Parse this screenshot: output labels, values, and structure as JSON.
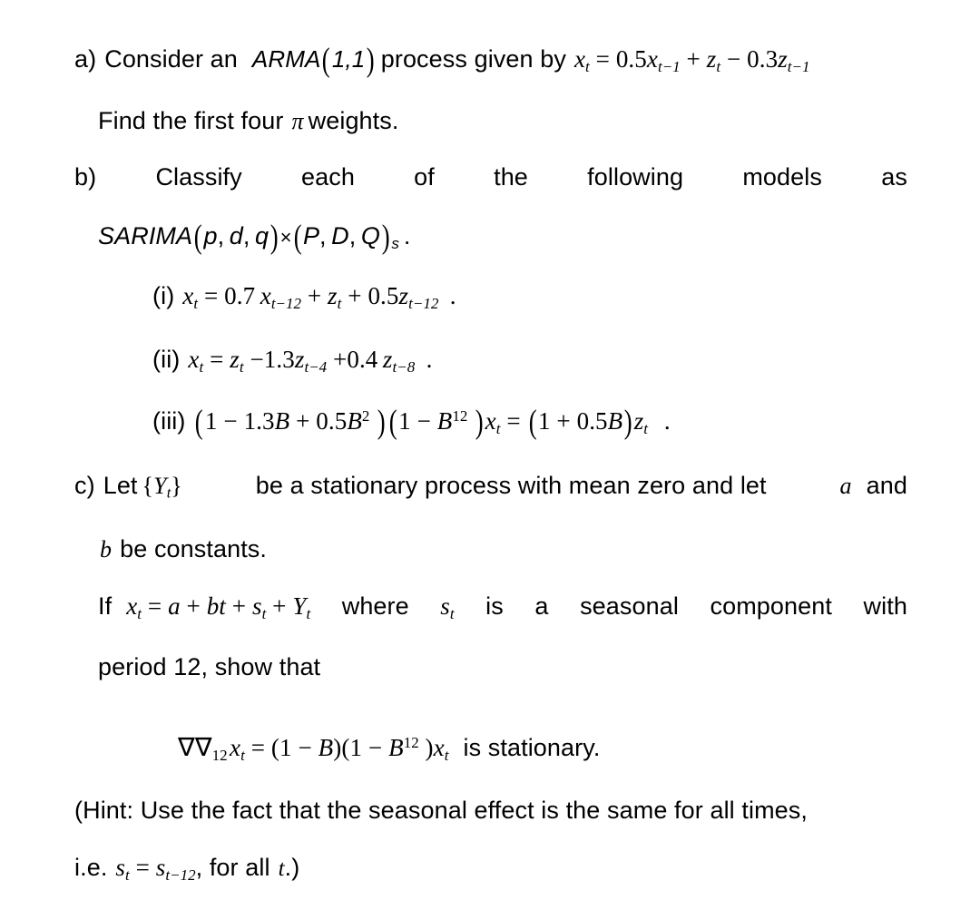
{
  "document": {
    "type": "exam-question-sheet",
    "background_color": "#ffffff",
    "text_color": "#000000"
  },
  "items": {
    "a": {
      "label": "a)",
      "line1_text_before": "Consider an",
      "line1_inline_math": "ARMA(1,1)",
      "line1_text_mid": "process given by",
      "line1_equation": "x_t = 0.5x_{t-1} + z_t - 0.3z_{t-1}",
      "line2_before": "Find the first four",
      "line2_symbol": "π",
      "line2_after": "weights."
    },
    "b": {
      "label": "b)",
      "line1_words": [
        "Classify",
        "each",
        "of",
        "the",
        "following",
        "models",
        "as"
      ],
      "line2_equation": "SARIMA(p,d,q) × (P,D,Q)_s ."
    },
    "sub_items": [
      {
        "marker": "(i)",
        "equation": "x_t = 0.7x_{t-12} + z_t + 0.5z_{t-12} ."
      },
      {
        "marker": "(ii)",
        "equation": "x_t = z_t - 1.3z_{t-4} + 0.4z_{t-8} ."
      },
      {
        "marker": "(iii)",
        "equation": "(1 - 1.3B + 0.5B^2)(1 - B^12)x_t = (1 + 0.5B)z_t ."
      }
    ],
    "c": {
      "label": "c)",
      "line1_words": [
        "Let",
        "{Y_t}",
        "be a stationary process with mean zero and let",
        "a",
        "and"
      ],
      "line1_plain": "Let {Yt}  be a stationary process with mean zero and let a  and",
      "line2_symbol": "b",
      "line2_after": "be constants.",
      "line3_words": [
        "If",
        "x_t = a + bt + s_t + Y_t",
        "where",
        "s_t",
        "is",
        "a",
        "seasonal",
        "component",
        "with"
      ],
      "line4": "period 12, show that",
      "display_equation": "∇∇_12 x_t = (1 - B)(1 - B^12)x_t",
      "display_equation_after": "is stationary."
    },
    "hint": {
      "line1": "(Hint: Use the fact that the seasonal effect is the same for all times,",
      "line2_prefix": "i.e.",
      "line2_equation": "s_t = s_{t-12}",
      "line2_mid": ", for all",
      "line2_symbol": "t",
      "line2_suffix": ".)"
    }
  },
  "symbols": {
    "pi": "π",
    "nabla": "∇",
    "times": "×",
    "minus": "−",
    "plus": "+",
    "equals": "="
  }
}
